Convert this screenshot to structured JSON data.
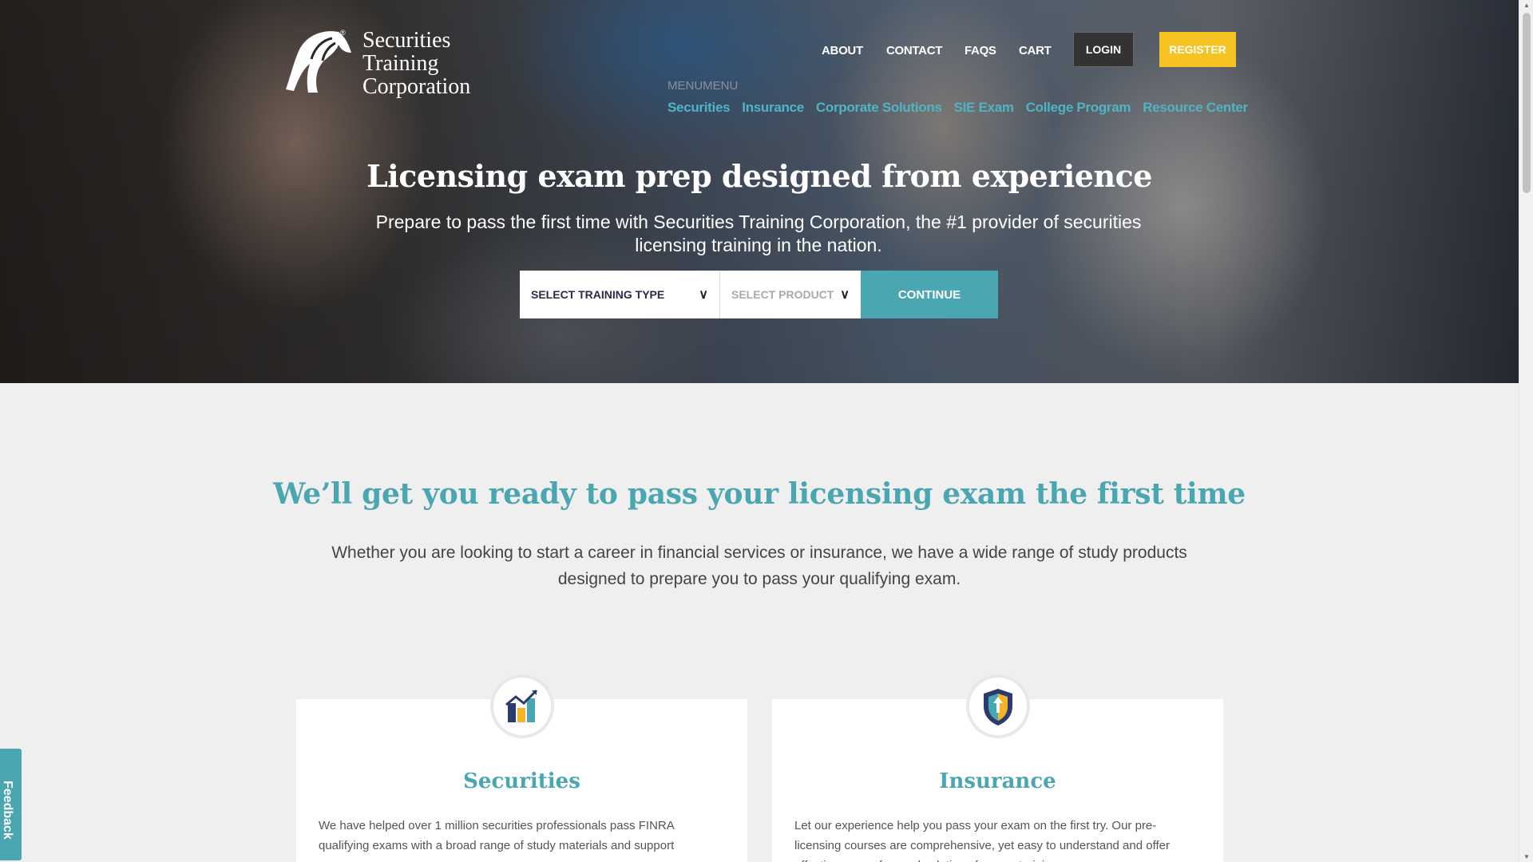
{
  "brand": {
    "line1": "Securities",
    "line2": "Training",
    "line3": "Corporation",
    "reg": "®"
  },
  "topnav": {
    "about": "ABOUT",
    "contact": "CONTACT",
    "faqs": "FAQS",
    "cart": "CART",
    "login": "LOGIN",
    "register": "REGISTER"
  },
  "menu_label": "MENUMENU",
  "catnav": [
    "Securities",
    "Insurance",
    "Corporate Solutions",
    "SIE Exam",
    "College Program",
    "Resource Center"
  ],
  "hero": {
    "title": "Licensing exam prep designed from experience",
    "subtitle": "Prepare to pass the first time with Securities Training Corporation, the #1 provider of securities licensing training in the nation.",
    "select_type": "SELECT TRAINING TYPE",
    "select_product": "SELECT PRODUCT",
    "continue": "CONTINUE"
  },
  "main": {
    "title": "We’ll get you ready to pass your licensing exam the first time",
    "description": "Whether you are looking to start a career in financial services or insurance, we have a wide range of study products designed to prepare you to pass your qualifying exam."
  },
  "cards": [
    {
      "title": "Securities",
      "text": "We have helped over 1 million securities professionals pass FINRA qualifying exams with a broad range of study materials and support",
      "icon": "chart-growth-icon"
    },
    {
      "title": "Insurance",
      "text": "Let our experience help you pass your exam on the first try. Our pre-licensing courses are comprehensive, yet easy to understand and offer effective, exam-focused solutions for your training",
      "icon": "shield-icon"
    }
  ],
  "feedback": "Feedback",
  "colors": {
    "accent": "#4aa6b0",
    "register": "#f6c322",
    "login": "#333333"
  }
}
